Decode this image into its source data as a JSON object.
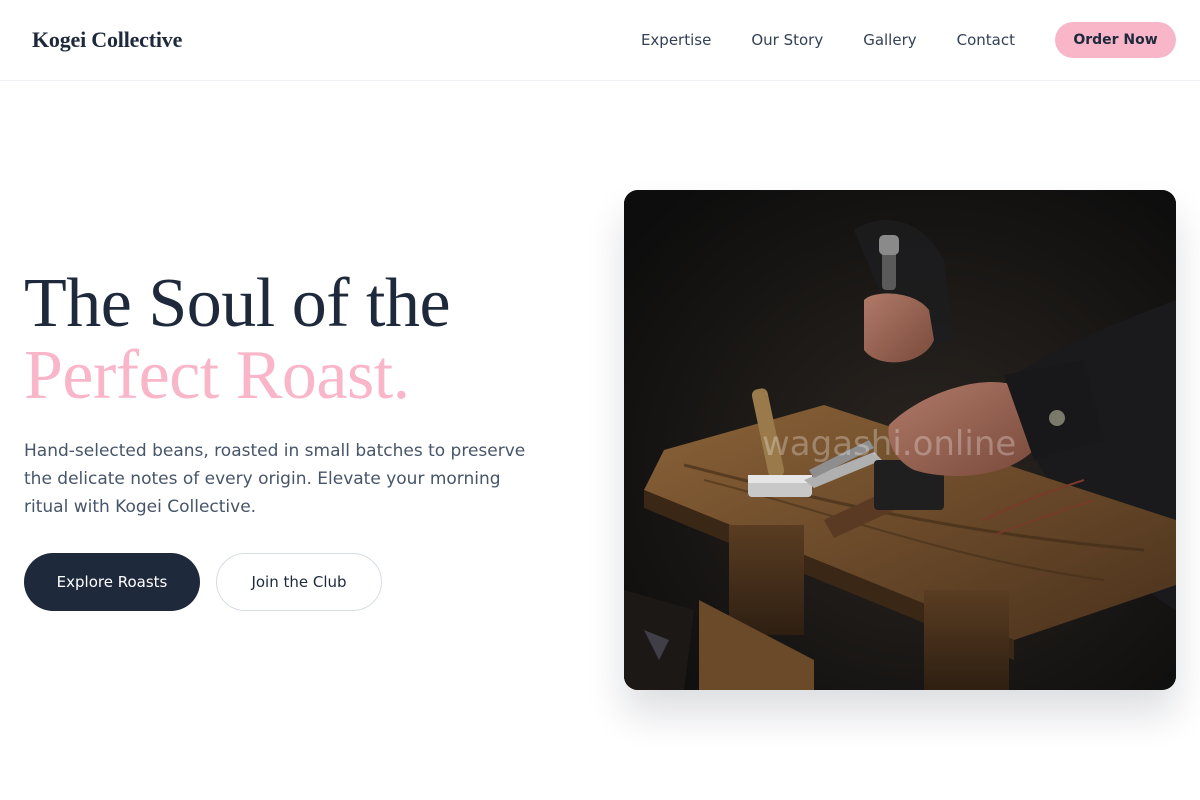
{
  "header": {
    "logo": "Kogei Collective",
    "nav": [
      {
        "label": "Expertise"
      },
      {
        "label": "Our Story"
      },
      {
        "label": "Gallery"
      },
      {
        "label": "Contact"
      }
    ],
    "cta_label": "Order Now"
  },
  "hero": {
    "title_line1": "The Soul of the",
    "title_line2": "Perfect Roast.",
    "description": "Hand-selected beans, roasted in small batches to preserve the delicate notes of every origin. Elevate your morning ritual with Kogei Collective.",
    "primary_button": "Explore Roasts",
    "secondary_button": "Join the Club",
    "image_watermark": "wagashi.online"
  },
  "colors": {
    "primary": "#1e293b",
    "accent_pink": "#f9b6c9",
    "body_text": "#475569"
  }
}
